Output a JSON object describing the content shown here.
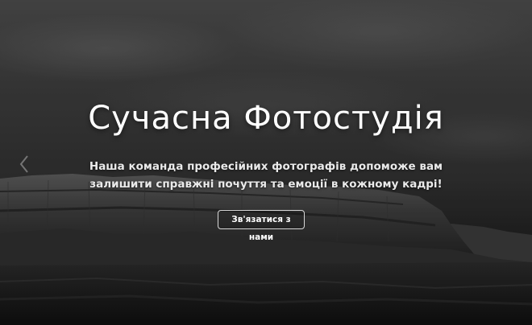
{
  "hero": {
    "title": "Сучасна Фотостудія",
    "subtitle": "Наша команда професійних фотографів допоможе вам залишити справжні почуття та емоції в кожному кадрі!",
    "button_label": "Зв'язатися з нами"
  },
  "carousel": {
    "prev_icon": "chevron-left-icon"
  },
  "colors": {
    "text": "#ffffff",
    "button_border": "#d8d8d8"
  }
}
